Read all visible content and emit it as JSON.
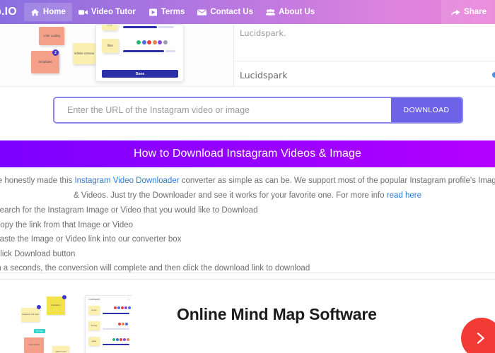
{
  "navbar": {
    "brand": "b.IO",
    "items": [
      {
        "label": "Home",
        "icon": "home-icon",
        "active": true
      },
      {
        "label": "Video Tutor",
        "icon": "video-camera-icon",
        "active": false
      },
      {
        "label": "Terms",
        "icon": "file-document-icon",
        "active": false
      },
      {
        "label": "Contact Us",
        "icon": "envelope-icon",
        "active": false
      },
      {
        "label": "About Us",
        "icon": "users-group-icon",
        "active": false
      }
    ],
    "share_label": "Share",
    "share_icon": "share-arrow-icon",
    "gradient_start": "#8a6fe0",
    "gradient_end": "#e87fd8"
  },
  "top_ad": {
    "notes": [
      {
        "text": "color coding"
      },
      {
        "text": "templates"
      },
      {
        "text": "infinite canvas"
      },
      {
        "text": "vote"
      },
      {
        "text": "filter"
      }
    ],
    "badge_count": "2",
    "done_label": "Done",
    "advertiser_line_1": "Lucidspark.",
    "advertiser_line_2": "Lucidspark"
  },
  "downloader": {
    "placeholder": "Enter the URL of the Instagram video or image",
    "value": "",
    "button_label": "DOWNLOAD",
    "button_color": "#6c63e8",
    "border_color": "#8d86ef"
  },
  "how_section": {
    "heading": "How to Download Instagram Videos & Image",
    "gradient_start": "#7c00ff",
    "gradient_end": "#b400ff",
    "intro_pre": "We honestly made this ",
    "intro_link_1": "Instagram Video Downloader",
    "intro_mid": " converter as simple as can be. We support most of the popular Instagram profile's Images & Videos. Just try the Downloader and see it works for your favorite one. For more info ",
    "intro_link_2": "read here",
    "link_color": "#2f7bd4",
    "steps": [
      "Search for the Instagram Image or Video that you would like to Download",
      "Copy the link from that Image or Video",
      "Paste the Image or Video link into our converter box",
      "Click Download button",
      "In a seconds, the conversion will complete and then click the download link to download"
    ]
  },
  "bottom_ad": {
    "headline": "Online Mind Map Software",
    "panel_title": "Lucidspark",
    "notes": [
      {
        "text": "sequence sub topic"
      },
      {
        "text": "brainstorm"
      },
      {
        "text": "color coding"
      },
      {
        "text": "status board"
      },
      {
        "text": "scope"
      },
      {
        "text": "fix bug"
      },
      {
        "text": "value"
      }
    ],
    "teal_tag": "STYLE",
    "next_button_icon": "chevron-right-icon",
    "next_button_color": "#f23b35"
  }
}
